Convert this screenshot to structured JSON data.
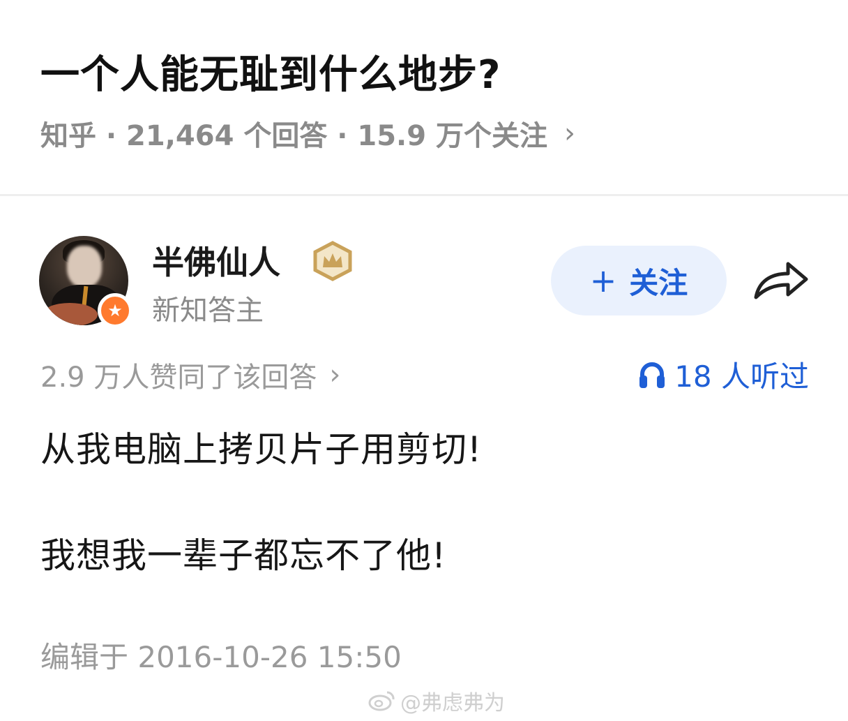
{
  "question": {
    "title": "一个人能无耻到什么地步?",
    "meta": "知乎 · 21,464 个回答 · 15.9 万个关注",
    "chevron": "›"
  },
  "author": {
    "name": "半佛仙人",
    "subtitle": "新知答主",
    "follow_label": "关注",
    "follow_plus": "+"
  },
  "stats": {
    "votes": "2.9 万人赞同了该回答",
    "votes_chevron": "›",
    "listened": "18 人听过"
  },
  "answer": {
    "line1": "从我电脑上拷贝片子用剪切!",
    "line2": "我想我一辈子都忘不了他!",
    "edited": "编辑于 2016-10-26 15:50"
  },
  "watermark": {
    "text": "@弗虑弗为"
  },
  "colors": {
    "accent_blue": "#1f5fd6",
    "follow_bg": "#eaf1fd",
    "badge_orange": "#ff7a2e",
    "crown_gold": "#c9a25a",
    "muted_text": "#8a8a8a"
  },
  "icons": [
    "chevron-right-icon",
    "crown-badge-icon",
    "star-badge-icon",
    "share-arrow-icon",
    "headphones-icon",
    "weibo-logo-icon"
  ]
}
